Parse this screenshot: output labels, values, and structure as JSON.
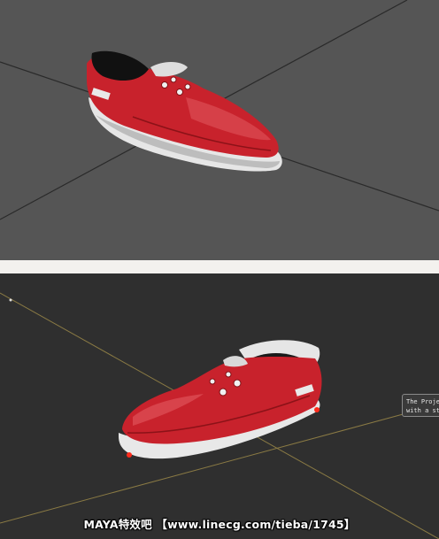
{
  "viewport_top": {
    "background": "#555555",
    "grid_color": "#2a2a2a"
  },
  "viewport_bottom": {
    "background": "#2f2f2f",
    "axis_color": "#8a7a44",
    "tooltip_text": "The Proje\nwith a st"
  },
  "shoe": {
    "upper_color": "#c8222c",
    "upper_highlight": "#e25a60",
    "sole_color": "#e8e8e8",
    "eyelet_color": "#f0f0f0",
    "marker_color": "#ff2a1a"
  },
  "watermark_text": "MAYA特效吧 【www.linecg.com/tieba/1745】"
}
